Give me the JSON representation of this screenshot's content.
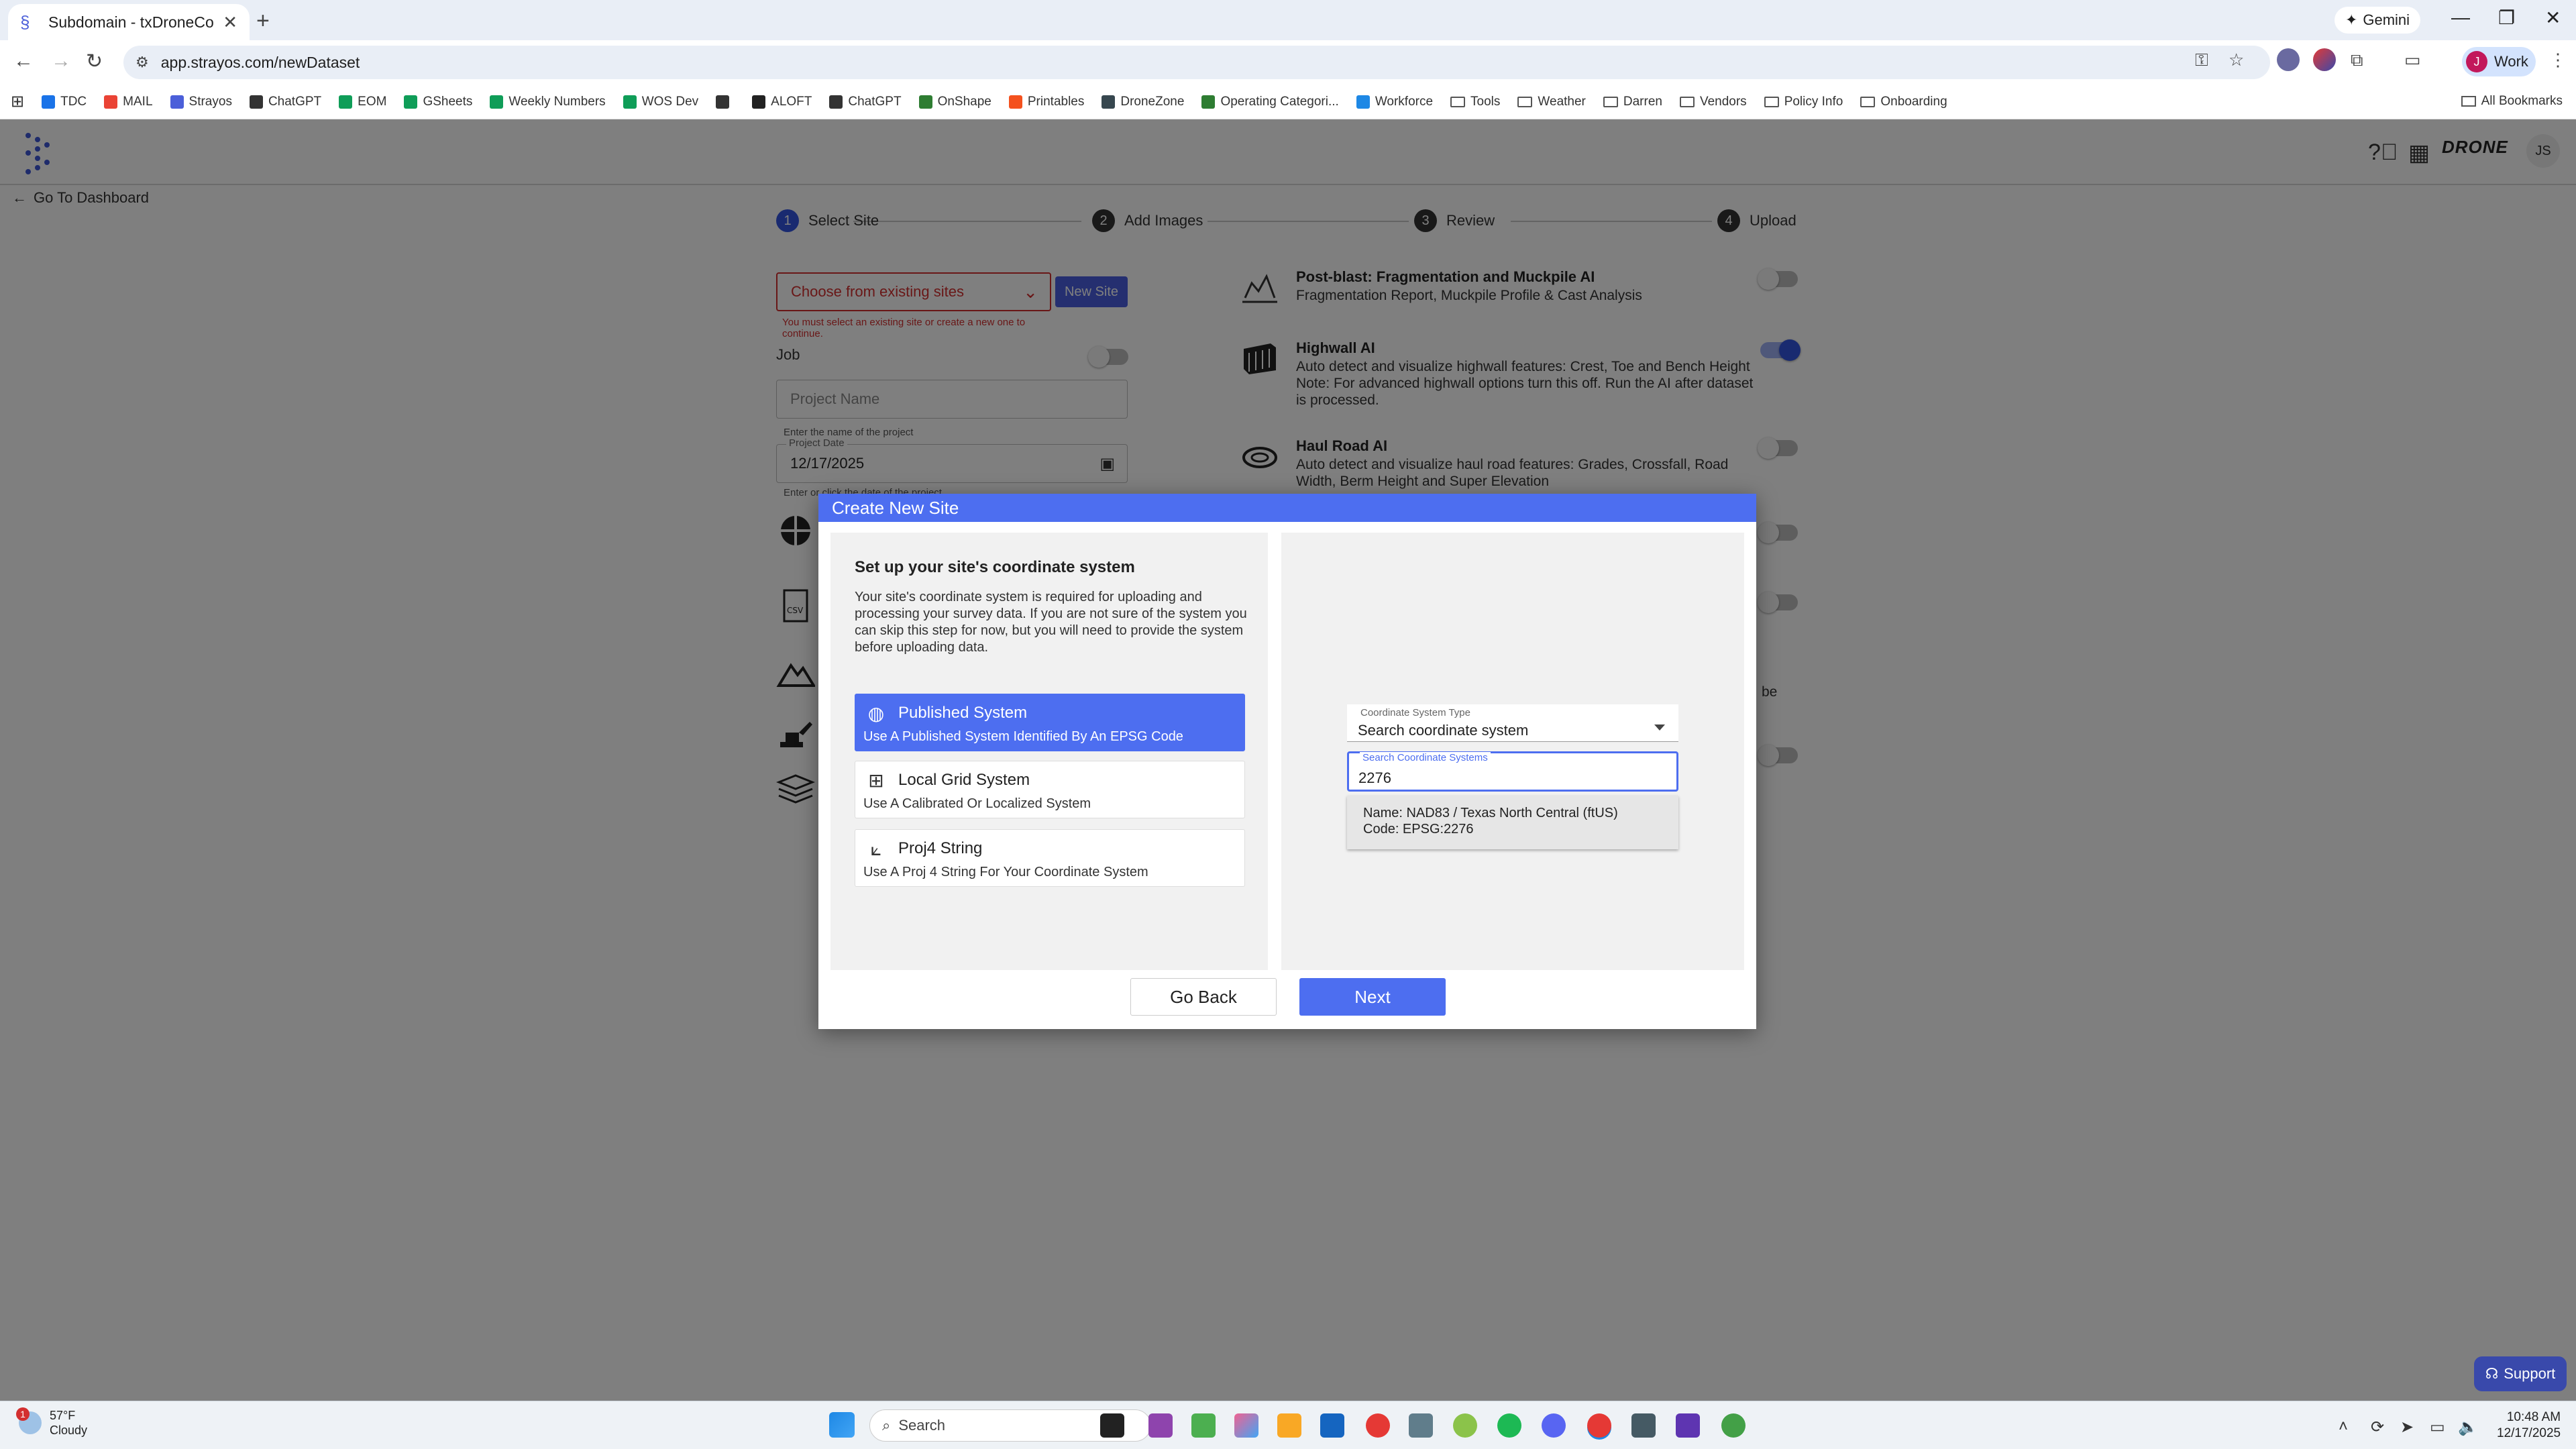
{
  "browser": {
    "tab_title": "Subdomain - txDroneCo - Dem",
    "url": "app.strayos.com/newDataset",
    "gemini_label": "Gemini",
    "profile_label": "Work",
    "profile_initial": "J",
    "bookmarks": [
      {
        "label": "TDC",
        "icon": "chevron-icon",
        "color": "#1a73e8"
      },
      {
        "label": "MAIL",
        "icon": "gmail-icon",
        "color": "#ea4335"
      },
      {
        "label": "Strayos",
        "icon": "strayos-icon",
        "color": "#4b5fd9"
      },
      {
        "label": "ChatGPT",
        "icon": "chatgpt-icon",
        "color": "#333333"
      },
      {
        "label": "EOM",
        "icon": "sheets-icon",
        "color": "#0f9d58"
      },
      {
        "label": "GSheets",
        "icon": "sheets-icon",
        "color": "#0f9d58"
      },
      {
        "label": "Weekly Numbers",
        "icon": "sheets-icon",
        "color": "#0f9d58"
      },
      {
        "label": "WOS Dev",
        "icon": "sheets-icon",
        "color": "#0f9d58"
      },
      {
        "label": "",
        "icon": "globe-icon",
        "color": "#333333"
      },
      {
        "label": "ALOFT",
        "icon": "aloft-icon",
        "color": "#222222"
      },
      {
        "label": "ChatGPT",
        "icon": "chatgpt-icon",
        "color": "#333333"
      },
      {
        "label": "OnShape",
        "icon": "onshape-icon",
        "color": "#2e7d32"
      },
      {
        "label": "Printables",
        "icon": "printables-icon",
        "color": "#f4511e"
      },
      {
        "label": "DroneZone",
        "icon": "dronezone-icon",
        "color": "#37474f"
      },
      {
        "label": "Operating Categori...",
        "icon": "faa-icon",
        "color": "#2e7d32"
      },
      {
        "label": "Workforce",
        "icon": "workforce-icon",
        "color": "#1e88e5"
      }
    ],
    "bookmark_folders": [
      "Tools",
      "Weather",
      "Darren",
      "Vendors",
      "Policy Info",
      "Onboarding"
    ],
    "all_bookmarks": "All Bookmarks"
  },
  "app": {
    "back_label": "Go To Dashboard",
    "brand_text": "DRONE",
    "user_initials": "JS",
    "steps": [
      {
        "num": "1",
        "label": "Select Site",
        "active": true
      },
      {
        "num": "2",
        "label": "Add Images",
        "active": false
      },
      {
        "num": "3",
        "label": "Review",
        "active": false
      },
      {
        "num": "4",
        "label": "Upload",
        "active": false
      }
    ],
    "site_select_placeholder": "Choose from existing sites",
    "new_site_label": "New Site",
    "site_error": "You must select an existing site or create a new one to continue.",
    "job_label": "Job",
    "project_name_placeholder": "Project Name",
    "project_name_helper": "Enter the name of the project",
    "project_date_label": "Project Date",
    "project_date_value": "12/17/2025",
    "project_date_helper": "Enter or click the date of the project",
    "features": [
      {
        "title": "Post-blast: Fragmentation and Muckpile AI",
        "desc": "Fragmentation Report, Muckpile Profile & Cast Analysis",
        "on": false
      },
      {
        "title": "Highwall AI",
        "desc": "Auto detect and visualize highwall features: Crest, Toe and Bench Height Note: For advanced highwall options turn this off. Run the AI after dataset is processed.",
        "on": true
      },
      {
        "title": "Haul Road AI",
        "desc": "Auto detect and visualize haul road features: Grades, Crossfall, Road Width, Berm Height and Super Elevation",
        "on": false
      }
    ],
    "partial_text_be": "be"
  },
  "modal": {
    "title": "Create New Site",
    "heading": "Set up your site's coordinate system",
    "description": "Your site's coordinate system is required for uploading and processing your survey data. If you are not sure of the system you can skip this step for now, but you will need to provide the system before uploading data.",
    "options": [
      {
        "title": "Published System",
        "subtitle": "Use A Published System Identified By An EPSG Code",
        "icon": "globe-icon",
        "selected": true
      },
      {
        "title": "Local Grid System",
        "subtitle": "Use A Calibrated Or Localized System",
        "icon": "grid-icon",
        "selected": false
      },
      {
        "title": "Proj4 String",
        "subtitle": "Use A Proj 4 String For Your Coordinate System",
        "icon": "axes-icon",
        "selected": false
      }
    ],
    "cs_type_label": "Coordinate System Type",
    "cs_type_value": "Search coordinate system",
    "search_label": "Search Coordinate Systems",
    "search_value": "2276",
    "result_name": "Name: NAD83 / Texas North Central (ftUS)",
    "result_code": "Code:  EPSG:2276",
    "back_button": "Go Back",
    "next_button": "Next"
  },
  "support_label": "Support",
  "taskbar": {
    "temp": "57°F",
    "condition": "Cloudy",
    "weather_badge": "1",
    "search_label": "Search",
    "time": "10:48 AM",
    "date": "12/17/2025"
  },
  "colors": {
    "accent": "#4d6ef0",
    "error": "#d32f2f"
  }
}
